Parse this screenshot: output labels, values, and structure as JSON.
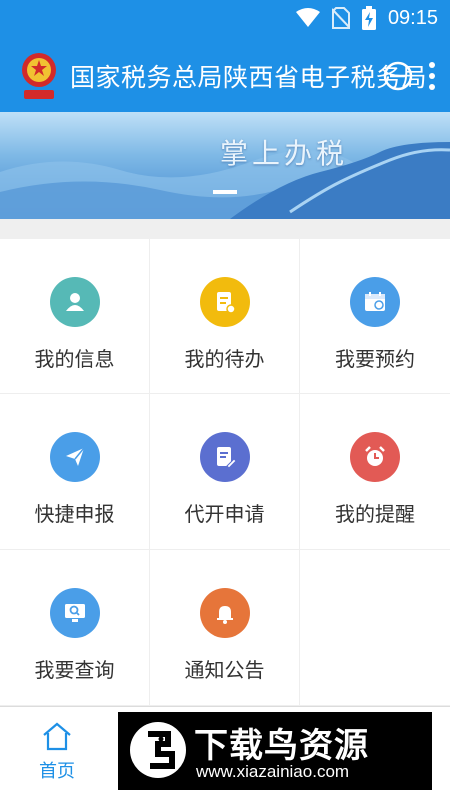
{
  "status": {
    "time": "09:15"
  },
  "header": {
    "title": "国家税务总局陕西省电子税务局"
  },
  "banner": {
    "text": "掌上办税"
  },
  "menu": [
    {
      "label": "我的信息",
      "icon": "user-icon",
      "color": "#56b9b6"
    },
    {
      "label": "我的待办",
      "icon": "todo-list-icon",
      "color": "#f2bb0d"
    },
    {
      "label": "我要预约",
      "icon": "calendar-icon",
      "color": "#4a9ee8"
    },
    {
      "label": "快捷申报",
      "icon": "paper-plane-icon",
      "color": "#4a9ee8"
    },
    {
      "label": "代开申请",
      "icon": "document-edit-icon",
      "color": "#5b6fd0"
    },
    {
      "label": "我的提醒",
      "icon": "alarm-clock-icon",
      "color": "#e25a55"
    },
    {
      "label": "我要查询",
      "icon": "search-monitor-icon",
      "color": "#4a9ee8"
    },
    {
      "label": "通知公告",
      "icon": "bell-icon",
      "color": "#e6753a"
    }
  ],
  "tabbar": {
    "home_label": "首页",
    "accent": "#1e90e6"
  },
  "watermark": {
    "title": "下载鸟资源",
    "url": "www.xiazainiao.com"
  }
}
